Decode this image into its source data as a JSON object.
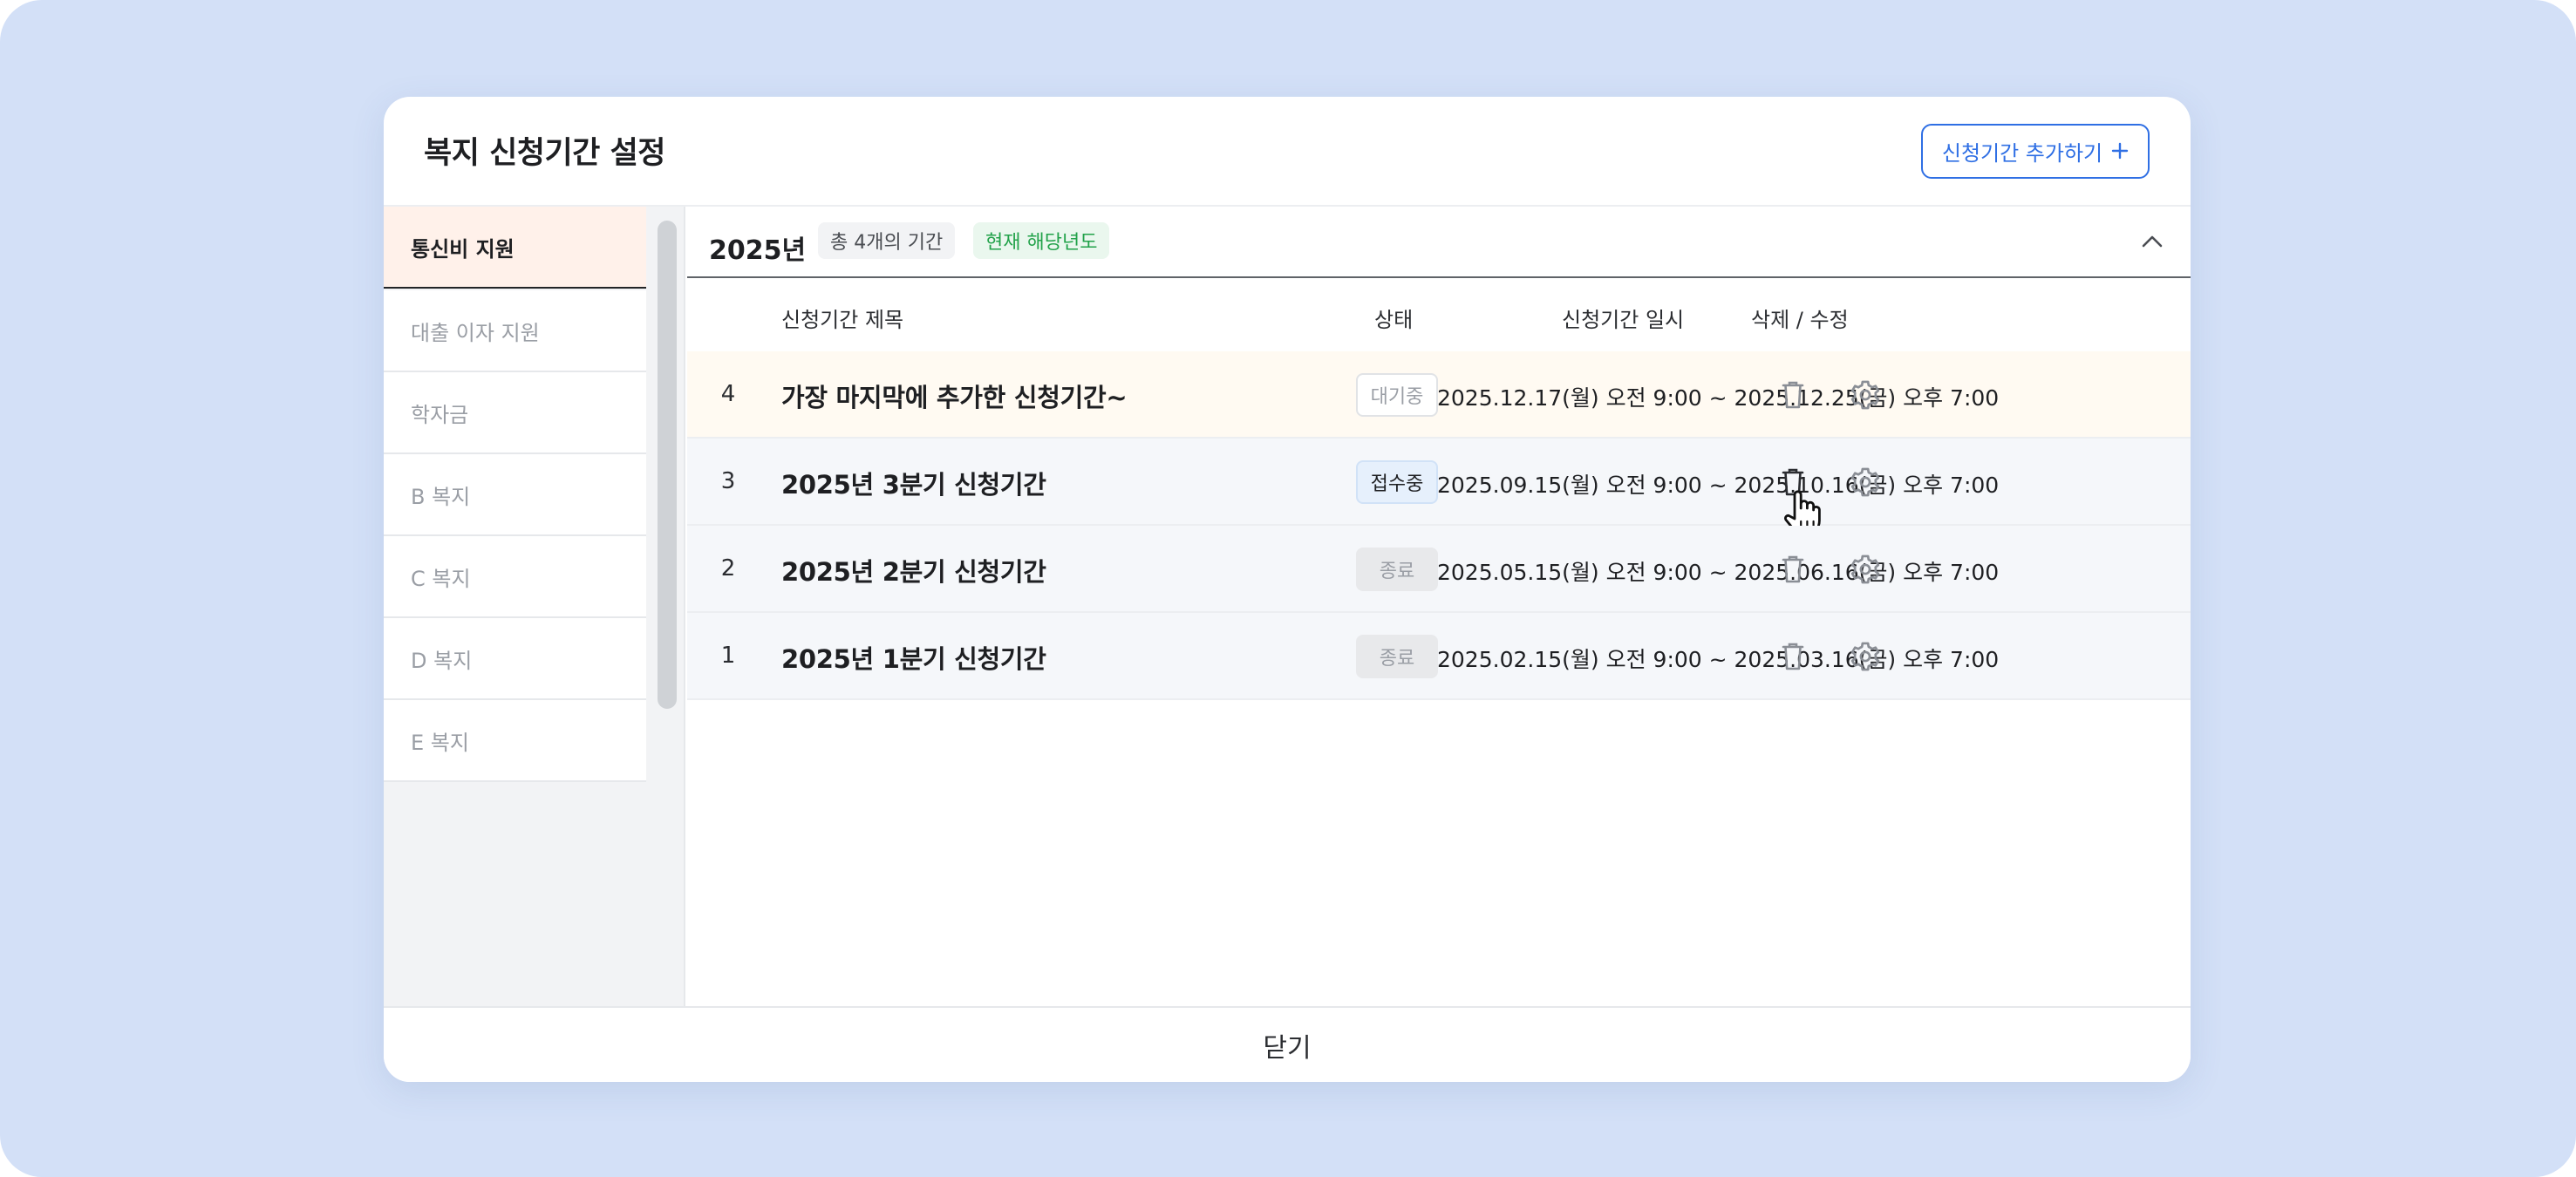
{
  "modal": {
    "title": "복지 신청기간 설정",
    "add_button_label": "신청기간 추가하기",
    "add_button_icon": "plus-icon",
    "close_label": "닫기"
  },
  "sidebar": {
    "items": [
      {
        "label": "통신비 지원",
        "active": true
      },
      {
        "label": "대출 이자 지원",
        "active": false
      },
      {
        "label": "학자금",
        "active": false
      },
      {
        "label": "B 복지",
        "active": false
      },
      {
        "label": "C 복지",
        "active": false
      },
      {
        "label": "D 복지",
        "active": false
      },
      {
        "label": "E 복지",
        "active": false
      }
    ]
  },
  "year_section": {
    "year": "2025년",
    "count_badge": "총 4개의 기간",
    "current_badge": "현재 해당년도",
    "collapse_icon": "chevron-up-icon"
  },
  "table": {
    "headers": {
      "title": "신청기간 제목",
      "status": "상태",
      "datetime": "신청기간 일시",
      "actions": "삭제 / 수정"
    },
    "rows": [
      {
        "num": "4",
        "title": "가장 마지막에 추가한 신청기간~",
        "status": "대기중",
        "status_type": "waiting",
        "datetime": "2025.12.17(월) 오전 9:00 ~ 2025.12.25(금) 오후 7:00"
      },
      {
        "num": "3",
        "title": "2025년 3분기 신청기간",
        "status": "접수중",
        "status_type": "receiving",
        "datetime": "2025.09.15(월) 오전 9:00 ~ 2025.10.16(금) 오후 7:00"
      },
      {
        "num": "2",
        "title": "2025년 2분기 신청기간",
        "status": "종료",
        "status_type": "ended",
        "datetime": "2025.05.15(월) 오전 9:00 ~ 2025.06.16(금) 오후 7:00"
      },
      {
        "num": "1",
        "title": "2025년 1분기 신청기간",
        "status": "종료",
        "status_type": "ended",
        "datetime": "2025.02.15(월) 오전 9:00 ~ 2025.03.16(금) 오후 7:00"
      }
    ]
  },
  "colors": {
    "backdrop": "#d3e0f7",
    "accent_blue": "#2f6fe4",
    "active_sidebar_bg": "#fff1ea",
    "current_badge_green": "#22a24a",
    "pending_row_bg": "#fffaf2"
  }
}
